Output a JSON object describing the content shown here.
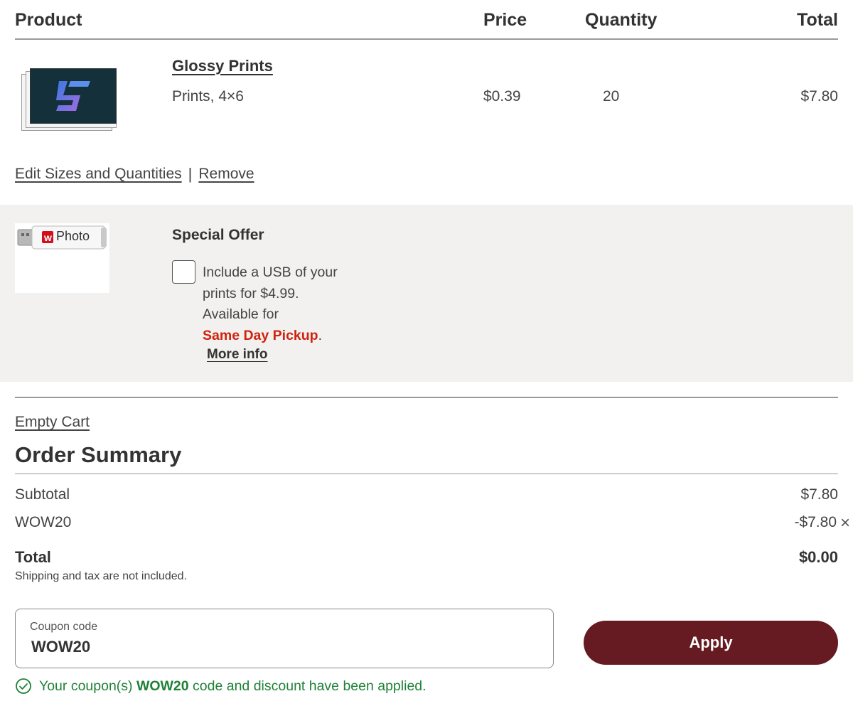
{
  "table_header": {
    "product": "Product",
    "price": "Price",
    "quantity": "Quantity",
    "total": "Total"
  },
  "line_item": {
    "thumbnail_icon": "stacked-photo-prints-icon",
    "title": "Glossy Prints",
    "subtitle": "Prints, 4×6",
    "price": "$0.39",
    "quantity": "20",
    "total": "$7.80"
  },
  "item_actions": {
    "edit": "Edit Sizes and Quantities",
    "separator": "|",
    "remove": "Remove"
  },
  "special_offer": {
    "usb_brand_text": "Photo",
    "title": "Special Offer",
    "line1": "Include a USB of your",
    "line2": "prints for $4.99.",
    "line3": "Available for",
    "highlight": "Same Day Pickup",
    "highlight_suffix": ".",
    "more_info": "More info",
    "checkbox_checked": false
  },
  "empty_cart": "Empty Cart",
  "order_summary": {
    "title": "Order Summary",
    "subtotal_label": "Subtotal",
    "subtotal_value": "$7.80",
    "discount_label": "WOW20",
    "discount_value": "-$7.80",
    "remove_discount": "×",
    "total_label": "Total",
    "total_value": "$0.00",
    "note": "Shipping and tax are not included."
  },
  "coupon": {
    "label": "Coupon code",
    "value": "WOW20",
    "apply": "Apply"
  },
  "message": {
    "prefix": "Your coupon(s) ",
    "code": "WOW20",
    "suffix": " code and discount have been applied."
  },
  "colors": {
    "apply_button": "#661a21",
    "success": "#1e8136",
    "highlight_red": "#d0220f",
    "offer_background": "#f2f1ef"
  }
}
